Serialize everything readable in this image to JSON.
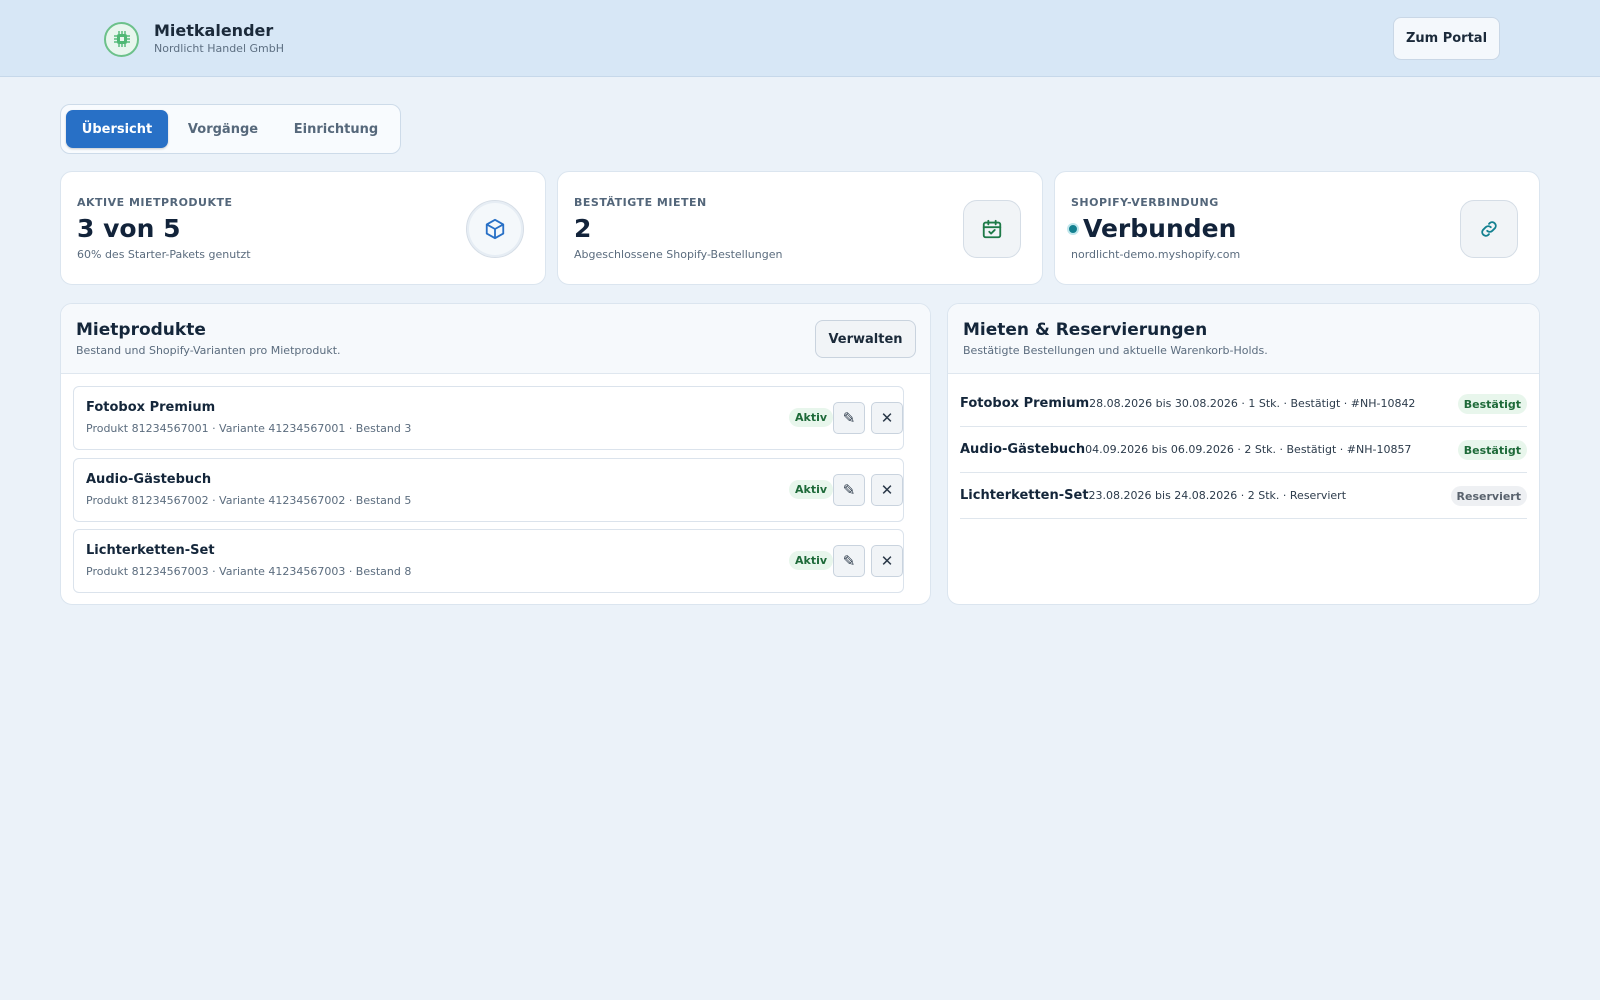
{
  "header": {
    "app_title": "Mietkalender",
    "company": "Nordlicht Handel GmbH",
    "portal_button": "Zum Portal"
  },
  "tabs": [
    {
      "label": "Übersicht",
      "active": true
    },
    {
      "label": "Vorgänge",
      "active": false
    },
    {
      "label": "Einrichtung",
      "active": false
    }
  ],
  "stats": [
    {
      "label": "AKTIVE MIETPRODUKTE",
      "value": "3 von 5",
      "desc": "60% des Starter-Pakets genutzt",
      "icon": "cube-icon"
    },
    {
      "label": "BESTÄTIGTE MIETEN",
      "value": "2",
      "desc": "Abgeschlossene Shopify-Bestellungen",
      "icon": "calendar-check-icon"
    },
    {
      "label": "SHOPIFY-VERBINDUNG",
      "value": "Verbunden",
      "desc": "nordlicht-demo.myshopify.com",
      "icon": "link-icon"
    }
  ],
  "products_panel": {
    "title": "Mietprodukte",
    "subtitle": "Bestand und Shopify-Varianten pro Mietprodukt.",
    "manage_button": "Verwalten",
    "items": [
      {
        "name": "Fotobox Premium",
        "meta": "Produkt 81234567001 · Variante 41234567001 · Bestand 3",
        "status": "Aktiv"
      },
      {
        "name": "Audio-Gästebuch",
        "meta": "Produkt 81234567002 · Variante 41234567002 · Bestand 5",
        "status": "Aktiv"
      },
      {
        "name": "Lichterketten-Set",
        "meta": "Produkt 81234567003 · Variante 41234567003 · Bestand 8",
        "status": "Aktiv"
      }
    ]
  },
  "rentals_panel": {
    "title": "Mieten & Reservierungen",
    "subtitle": "Bestätigte Bestellungen und aktuelle Warenkorb-Holds.",
    "items": [
      {
        "name": "Fotobox Premium",
        "meta": "28.08.2026 bis 30.08.2026 · 1 Stk. · Bestätigt · #NH-10842",
        "status": "Bestätigt"
      },
      {
        "name": "Audio-Gästebuch",
        "meta": "04.09.2026 bis 06.09.2026 · 2 Stk. · Bestätigt · #NH-10857",
        "status": "Bestätigt"
      },
      {
        "name": "Lichterketten-Set",
        "meta": "23.08.2026 bis 24.08.2026 · 2 Stk. · Reserviert",
        "status": "Reserviert"
      }
    ]
  },
  "colors": {
    "primary": "#2870c6",
    "success": "#1e6a39",
    "connected": "#138090",
    "background": "#ebf2f9"
  }
}
